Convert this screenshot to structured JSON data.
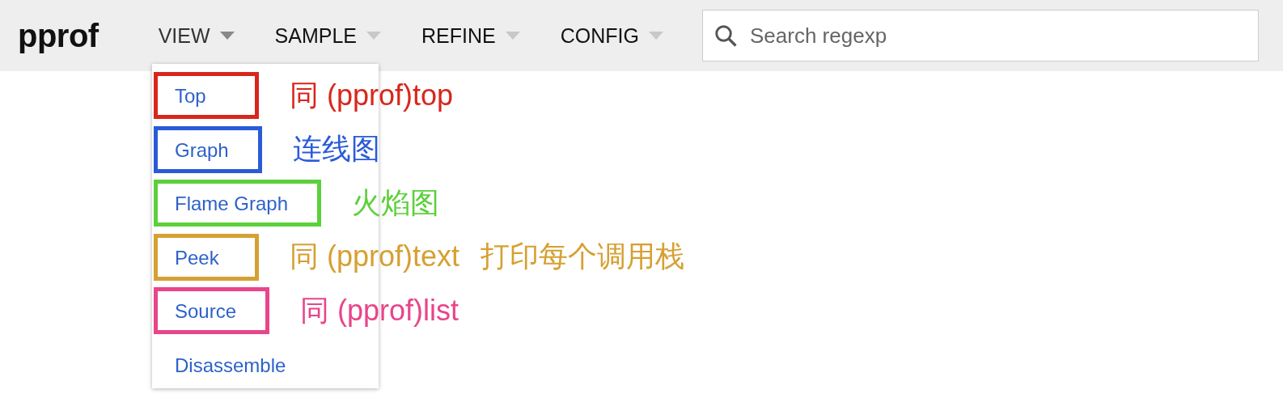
{
  "app": {
    "logo": "pprof"
  },
  "menus": [
    {
      "label": "VIEW",
      "open": true
    },
    {
      "label": "SAMPLE",
      "open": false
    },
    {
      "label": "REFINE",
      "open": false
    },
    {
      "label": "CONFIG",
      "open": false
    }
  ],
  "search": {
    "placeholder": "Search regexp"
  },
  "view_menu": {
    "items": [
      {
        "label": "Top",
        "color": "#d9261c",
        "notes": [
          "同 (pprof)top"
        ]
      },
      {
        "label": "Graph",
        "color": "#2a5bd7",
        "notes": [
          "连线图"
        ]
      },
      {
        "label": "Flame Graph",
        "color": "#5cd03a",
        "notes": [
          "火焰图"
        ]
      },
      {
        "label": "Peek",
        "color": "#d6a033",
        "notes": [
          "同 (pprof)text",
          "打印每个调用栈"
        ]
      },
      {
        "label": "Source",
        "color": "#e8458a",
        "notes": [
          "同 (pprof)list"
        ]
      },
      {
        "label": "Disassemble"
      }
    ]
  }
}
